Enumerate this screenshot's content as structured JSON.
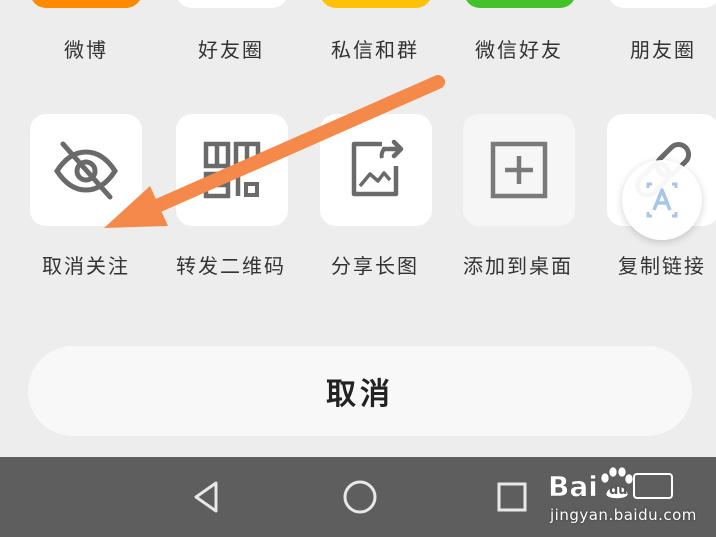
{
  "share_sheet": {
    "top_row": [
      {
        "label": "微博",
        "icon": "weibo-icon"
      },
      {
        "label": "好友圈",
        "icon": "friends-circle-icon"
      },
      {
        "label": "私信和群",
        "icon": "private-message-icon"
      },
      {
        "label": "微信好友",
        "icon": "wechat-icon"
      },
      {
        "label": "朋友圈",
        "icon": "moments-icon"
      }
    ],
    "action_row": [
      {
        "label": "取消关注",
        "icon": "eye-off-icon"
      },
      {
        "label": "转发二维码",
        "icon": "qr-code-icon"
      },
      {
        "label": "分享长图",
        "icon": "share-image-icon"
      },
      {
        "label": "添加到桌面",
        "icon": "add-to-desktop-icon"
      },
      {
        "label": "复制链接",
        "icon": "link-icon"
      }
    ],
    "cancel_label": "取消"
  },
  "navigation_bar": {
    "buttons": [
      "back-icon",
      "home-icon",
      "recents-icon"
    ]
  },
  "watermark": {
    "text": "jingyan.baidu.com",
    "logo": "baidu-jingyan-logo"
  },
  "colors": {
    "background": "#ededed",
    "arrow": "#f4894a",
    "navbar": "#5e5e5e"
  }
}
